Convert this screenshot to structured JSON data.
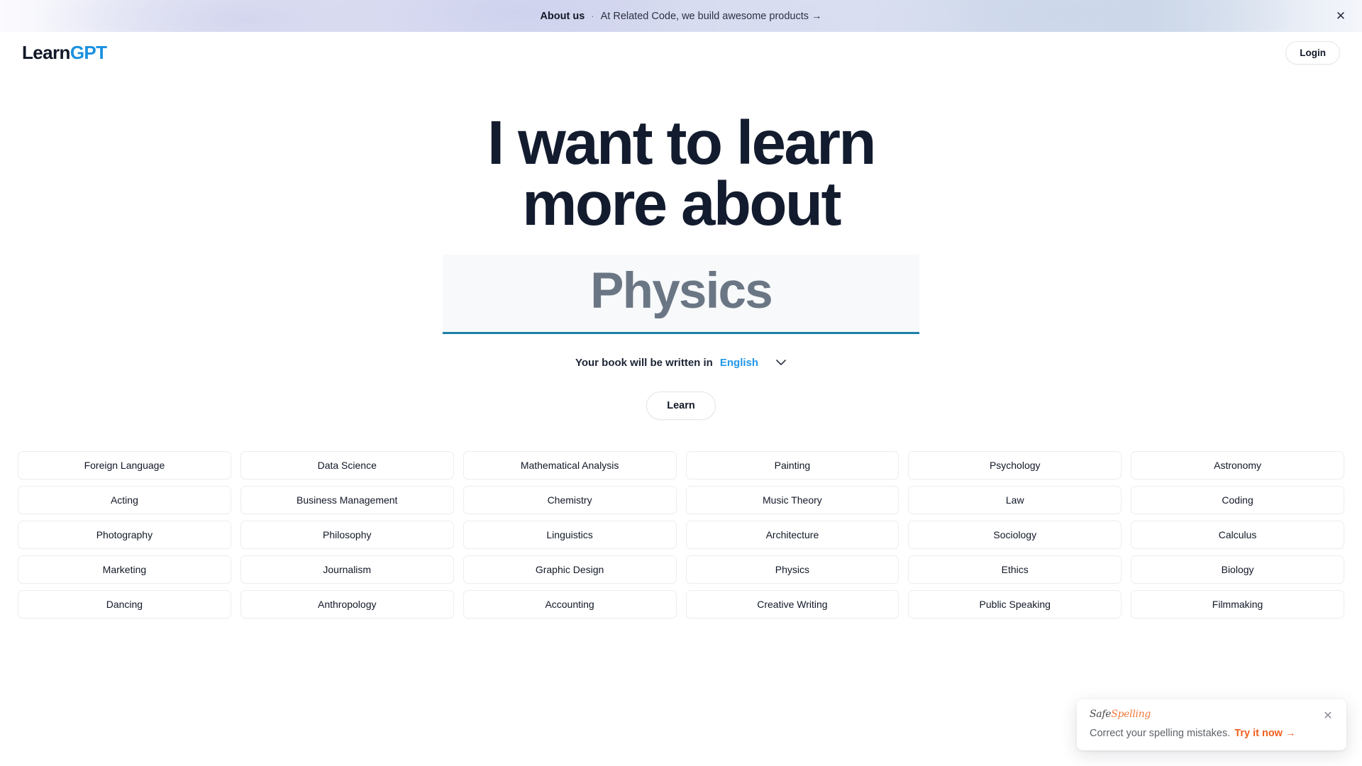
{
  "announcement": {
    "link_label": "About us",
    "separator": "·",
    "text": "At Related Code, we build awesome products →",
    "close_icon": "close-icon"
  },
  "header": {
    "logo_primary": "Learn",
    "logo_accent": "GPT",
    "login_label": "Login"
  },
  "hero": {
    "headline_line1": "I want to learn",
    "headline_line2": "more about",
    "topic_input_value": "Physics",
    "topic_input_placeholder": "Physics",
    "language_label": "Your book will be written in",
    "language_value": "English",
    "language_chevron_icon": "chevron-down-icon",
    "learn_label": "Learn"
  },
  "topics": [
    "Foreign Language",
    "Data Science",
    "Mathematical Analysis",
    "Painting",
    "Psychology",
    "Astronomy",
    "Acting",
    "Business Management",
    "Chemistry",
    "Music Theory",
    "Law",
    "Coding",
    "Photography",
    "Philosophy",
    "Linguistics",
    "Architecture",
    "Sociology",
    "Calculus",
    "Marketing",
    "Journalism",
    "Graphic Design",
    "Physics",
    "Ethics",
    "Biology",
    "Dancing",
    "Anthropology",
    "Accounting",
    "Creative Writing",
    "Public Speaking",
    "Filmmaking"
  ],
  "toast": {
    "logo_primary": "Safe",
    "logo_accent": "Spelling",
    "message": "Correct your spelling mistakes.",
    "cta": "Try it now →",
    "close_icon": "close-icon"
  },
  "colors": {
    "logo_accent": "#1a90e0",
    "input_underline": "#1d80a8",
    "language_link": "#2196e8",
    "toast_accent": "#f0601f",
    "headline": "#131c2e"
  }
}
